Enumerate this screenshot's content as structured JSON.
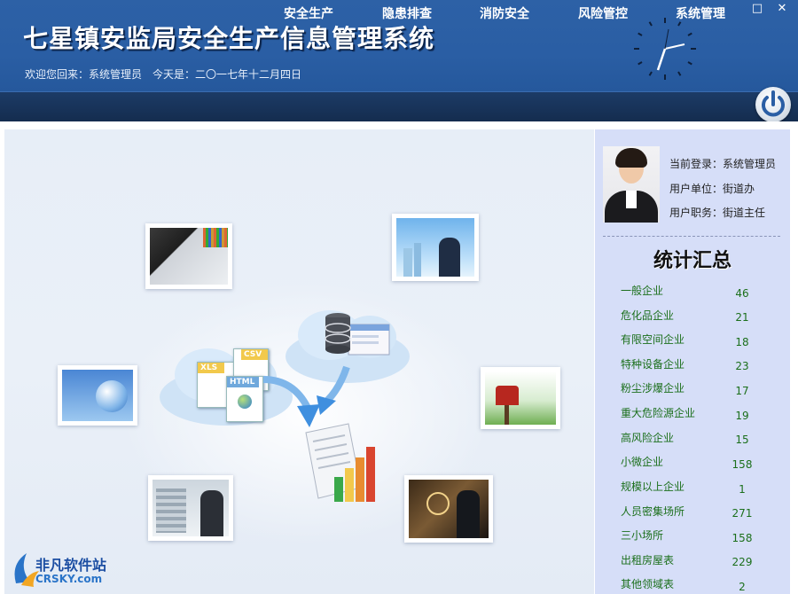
{
  "header": {
    "title": "七星镇安监局安全生产信息管理系统",
    "welcome": "欢迎您回来：系统管理员",
    "date": "今天是：二〇一七年十二月四日"
  },
  "window_controls": {
    "maximize": "□",
    "close": "✕"
  },
  "nav": {
    "items": [
      "安全生产",
      "隐患排查",
      "消防安全",
      "风险管控",
      "系统管理"
    ]
  },
  "user": {
    "login": "当前登录：系统管理员",
    "unit": "用户单位：街道办",
    "position": "用户职务：街道主任"
  },
  "stats": {
    "title": "统计汇总",
    "items": [
      {
        "label": "一般企业",
        "value": "46"
      },
      {
        "label": "危化品企业",
        "value": "21"
      },
      {
        "label": "有限空间企业",
        "value": "18"
      },
      {
        "label": "特种设备企业",
        "value": "23"
      },
      {
        "label": "粉尘涉爆企业",
        "value": "17"
      },
      {
        "label": "重大危险源企业",
        "value": "19"
      },
      {
        "label": "高风险企业",
        "value": "15"
      },
      {
        "label": "小微企业",
        "value": "158"
      },
      {
        "label": "规模以上企业",
        "value": "1"
      },
      {
        "label": "人员密集场所",
        "value": "271"
      },
      {
        "label": "三小场所",
        "value": "158"
      },
      {
        "label": "出租房屋表",
        "value": "229"
      },
      {
        "label": "其他领域表",
        "value": "2"
      }
    ]
  },
  "illustration": {
    "file_labels": [
      "XLS",
      "CSV",
      "HTML"
    ]
  },
  "watermark": {
    "cn": "非凡软件站",
    "en": "CRSKY.com"
  },
  "colors": {
    "header": "#2d61a6",
    "nav": "#1a355c",
    "side": "#d6def8",
    "stat_text": "#1b6f1b"
  }
}
